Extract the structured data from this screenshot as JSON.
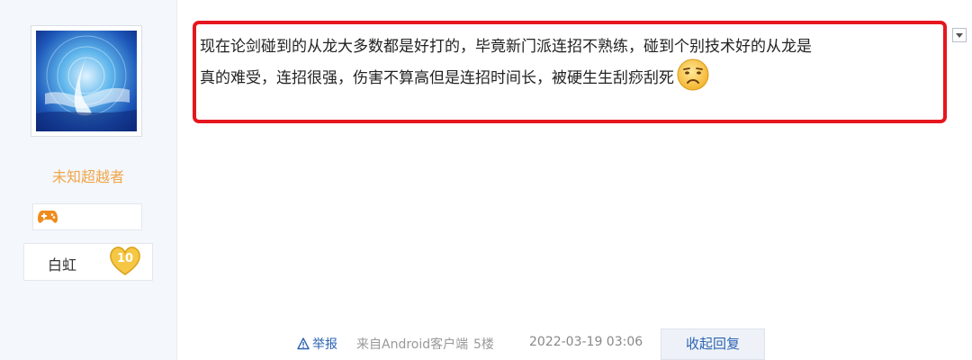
{
  "user": {
    "username": "未知超越者",
    "avatar_icon": "avatar-image",
    "game_badge_icon": "gamepad-icon",
    "level_name": "白虹",
    "level_number": "10"
  },
  "post": {
    "content_line1": "现在论剑碰到的从龙大多数都是好打的，毕竟新门派连招不熟练，碰到个别技术好的从龙是",
    "content_line2": "真的难受，连招很强，伤害不算高但是连招时间长，被硬生生刮痧刮死",
    "emoji_icon": "frowning-face-emoji",
    "highlight_color": "#e5171e"
  },
  "footer": {
    "report_label": "举报",
    "source": "来自Android客户端",
    "floor": "5楼",
    "timestamp": "2022-03-19 03:06",
    "reply_label": "收起回复"
  },
  "colors": {
    "username": "#f0a64a",
    "link": "#2d64b3",
    "panel_bg": "#f4f7fb"
  }
}
